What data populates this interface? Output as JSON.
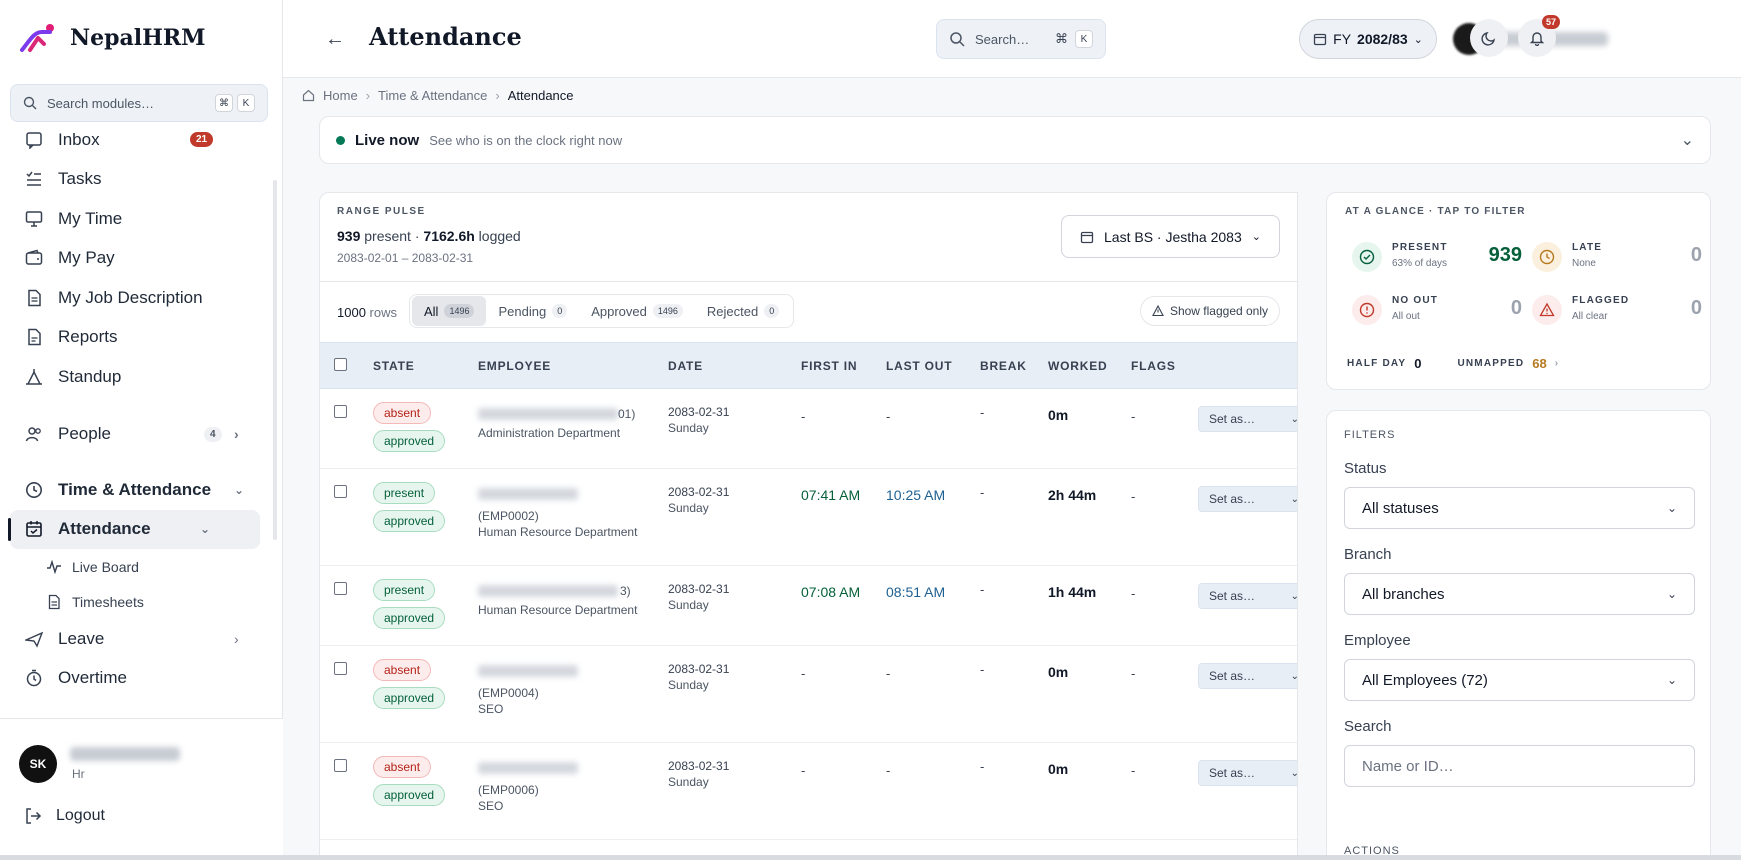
{
  "brand": {
    "name": "NepalHRM"
  },
  "sidebar": {
    "search_placeholder": "Search modules…",
    "search_kbd": [
      "⌘",
      "K"
    ],
    "items": [
      {
        "label": "Inbox",
        "badge": "21"
      },
      {
        "label": "Tasks"
      },
      {
        "label": "My Time"
      },
      {
        "label": "My Pay"
      },
      {
        "label": "My Job Description"
      },
      {
        "label": "Reports"
      },
      {
        "label": "Standup"
      }
    ],
    "people": {
      "label": "People",
      "badge": "4"
    },
    "time_attendance": {
      "label": "Time & Attendance"
    },
    "attendance": {
      "label": "Attendance"
    },
    "sub_items": [
      {
        "label": "Live Board"
      },
      {
        "label": "Timesheets"
      }
    ],
    "leave": {
      "label": "Leave"
    },
    "overtime": {
      "label": "Overtime"
    },
    "user": {
      "initials": "SK",
      "role": "Hr"
    },
    "logout": "Logout"
  },
  "topbar": {
    "title": "Attendance",
    "search_placeholder": "Search…",
    "search_kbd": [
      "⌘",
      "K"
    ],
    "fy_prefix": "FY",
    "fy_value": "2082/83",
    "notifications": "57"
  },
  "breadcrumb": [
    "Home",
    "Time & Attendance",
    "Attendance"
  ],
  "live": {
    "title": "Live now",
    "subtitle": "See who is on the clock right now"
  },
  "range_pulse": {
    "label": "RANGE PULSE",
    "present": "939",
    "present_text": "present",
    "logged": "7162.6h",
    "logged_text": "logged",
    "range": "2083-02-01 – 2083-02-31",
    "range_button": "Last BS · Jestha 2083"
  },
  "toolbar": {
    "rows": "1000",
    "rows_text": "rows",
    "segments": [
      {
        "label": "All",
        "count": "1496"
      },
      {
        "label": "Pending",
        "count": "0"
      },
      {
        "label": "Approved",
        "count": "1496"
      },
      {
        "label": "Rejected",
        "count": "0"
      }
    ],
    "flagged": "Show flagged only"
  },
  "table": {
    "headers": [
      "STATE",
      "EMPLOYEE",
      "DATE",
      "FIRST IN",
      "LAST OUT",
      "BREAK",
      "WORKED",
      "FLAGS"
    ],
    "rows": [
      {
        "state": "absent",
        "status": "approved",
        "emp_id": "01)",
        "dept": "Administration Department",
        "date": "2083-02-31",
        "day": "Sunday",
        "first_in": "-",
        "last_out": "-",
        "break": "-",
        "worked": "0m",
        "flags": "-",
        "action": "Set as…"
      },
      {
        "state": "present",
        "status": "approved",
        "emp_id": "(EMP0002)",
        "dept": "Human Resource Department",
        "date": "2083-02-31",
        "day": "Sunday",
        "first_in": "07:41 AM",
        "last_out": "10:25 AM",
        "break": "-",
        "worked": "2h 44m",
        "flags": "-",
        "action": "Set as…"
      },
      {
        "state": "present",
        "status": "approved",
        "emp_id": "3)",
        "dept": "Human Resource Department",
        "date": "2083-02-31",
        "day": "Sunday",
        "first_in": "07:08 AM",
        "last_out": "08:51 AM",
        "break": "-",
        "worked": "1h 44m",
        "flags": "-",
        "action": "Set as…"
      },
      {
        "state": "absent",
        "status": "approved",
        "emp_id": "(EMP0004)",
        "dept": "SEO",
        "date": "2083-02-31",
        "day": "Sunday",
        "first_in": "-",
        "last_out": "-",
        "break": "-",
        "worked": "0m",
        "flags": "-",
        "action": "Set as…"
      },
      {
        "state": "absent",
        "status": "approved",
        "emp_id": "(EMP0006)",
        "dept": "SEO",
        "date": "2083-02-31",
        "day": "Sunday",
        "first_in": "-",
        "last_out": "-",
        "break": "-",
        "worked": "0m",
        "flags": "-",
        "action": "Set as…"
      }
    ]
  },
  "glance": {
    "label": "AT A GLANCE · TAP TO FILTER",
    "stats": [
      {
        "name": "PRESENT",
        "sub": "63% of days",
        "value": "939",
        "color": "#05603a"
      },
      {
        "name": "LATE",
        "sub": "None",
        "value": "0",
        "color": "#b7791f"
      },
      {
        "name": "NO OUT",
        "sub": "All out",
        "value": "0",
        "color": "#c0392b"
      },
      {
        "name": "FLAGGED",
        "sub": "All clear",
        "value": "0",
        "color": "#c0392b"
      }
    ],
    "half_day_label": "HALF DAY",
    "half_day": "0",
    "unmapped_label": "UNMAPPED",
    "unmapped": "68"
  },
  "filters": {
    "title": "FILTERS",
    "status_label": "Status",
    "status_value": "All statuses",
    "branch_label": "Branch",
    "branch_value": "All branches",
    "employee_label": "Employee",
    "employee_value": "All Employees (72)",
    "search_label": "Search",
    "search_placeholder": "Name or ID…",
    "actions_label": "ACTIONS"
  }
}
